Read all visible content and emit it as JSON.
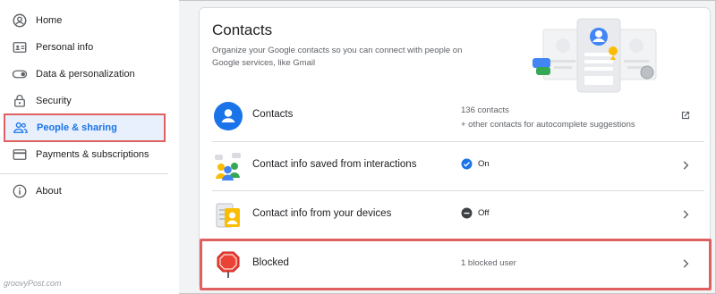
{
  "sidebar": {
    "items": [
      {
        "label": "Home",
        "icon": "home-icon"
      },
      {
        "label": "Personal info",
        "icon": "id-card-icon"
      },
      {
        "label": "Data & personalization",
        "icon": "toggle-icon"
      },
      {
        "label": "Security",
        "icon": "lock-icon"
      },
      {
        "label": "People & sharing",
        "icon": "people-icon",
        "active": true
      },
      {
        "label": "Payments & subscriptions",
        "icon": "credit-card-icon"
      },
      {
        "label": "About",
        "icon": "info-icon"
      }
    ]
  },
  "watermark": "groovyPost.com",
  "main": {
    "title": "Contacts",
    "description": "Organize your Google contacts so you can connect with people on Google services, like Gmail",
    "rows": [
      {
        "title": "Contacts",
        "value_line1": "136 contacts",
        "value_line2": "+ other contacts for autocomplete suggestions",
        "action_icon": "open-in-new-icon"
      },
      {
        "title": "Contact info saved from interactions",
        "status": "On",
        "status_icon": "check-circle-icon",
        "action_icon": "chevron-right-icon"
      },
      {
        "title": "Contact info from your devices",
        "status": "Off",
        "status_icon": "minus-circle-icon",
        "action_icon": "chevron-right-icon"
      },
      {
        "title": "Blocked",
        "value": "1 blocked user",
        "action_icon": "chevron-right-icon"
      }
    ]
  },
  "colors": {
    "accent": "#1a73e8",
    "highlight": "#e06060",
    "active_bg": "#e8f0fe"
  }
}
